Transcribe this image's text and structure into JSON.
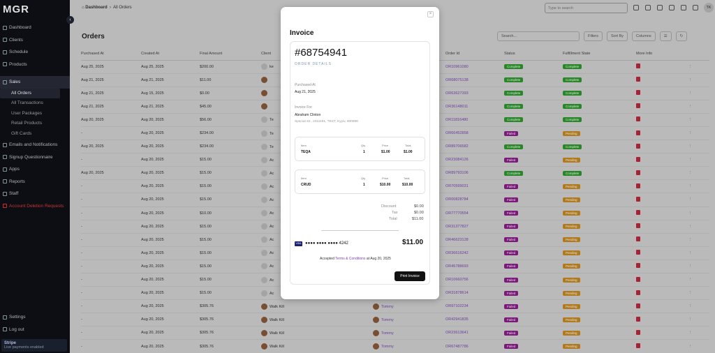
{
  "app": {
    "logo": "MGR"
  },
  "sidebar": {
    "items": [
      {
        "label": "Dashboard"
      },
      {
        "label": "Clients"
      },
      {
        "label": "Schedule"
      },
      {
        "label": "Products"
      },
      {
        "label": "Sales"
      }
    ],
    "sales_sub": [
      "All Orders",
      "All Transactions",
      "User Packages",
      "Retail Products",
      "Gift Cards"
    ],
    "items2": [
      {
        "label": "Emails and Notifications"
      },
      {
        "label": "Signup Questionnaire"
      },
      {
        "label": "Apps"
      },
      {
        "label": "Reports"
      },
      {
        "label": "Staff"
      },
      {
        "label": "Account Deletion Requests"
      }
    ],
    "settings": "Settings",
    "logout": "Log out",
    "stripe_title": "Stripe",
    "stripe_sub": "Live payments enabled"
  },
  "header": {
    "crumb_home": "Dashboard",
    "crumb_current": "All Orders",
    "search_placeholder": "Type to search",
    "avatar_initials": "TK"
  },
  "orders": {
    "title": "Orders",
    "search_placeholder": "Search...",
    "filters": "Filters",
    "sort": "Sort By",
    "columns": "Columns",
    "headers": [
      "Purchased At",
      "Created At",
      "Final Amount",
      "Client",
      "",
      "Order Id",
      "Status",
      "Fulfillment State",
      "More Info"
    ],
    "rows": [
      [
        "Aug 25, 2025",
        "Aug 25, 2025",
        "$200.00",
        "ke",
        "",
        "OR10961080",
        "Complete",
        "Complete"
      ],
      [
        "Aug 21, 2025",
        "Aug 21, 2025",
        "$11.00",
        "",
        "",
        "OR68075138",
        "Complete",
        "Complete"
      ],
      [
        "Aug 21, 2025",
        "Aug 15, 2025",
        "$0.00",
        "",
        "",
        "OR63627393",
        "Complete",
        "Complete"
      ],
      [
        "Aug 21, 2025",
        "Aug 21, 2025",
        "$45.00",
        "",
        "",
        "OR36148011",
        "Complete",
        "Complete"
      ],
      [
        "Aug 20, 2025",
        "Aug 20, 2025",
        "$56.00",
        "Te",
        "",
        "OR11816480",
        "Complete",
        "Complete"
      ],
      [
        "-",
        "Aug 20, 2025",
        "$234.00",
        "Te",
        "",
        "OR66452858",
        "Failed",
        "Pending"
      ],
      [
        "Aug 20, 2025",
        "Aug 20, 2025",
        "$234.00",
        "Te",
        "",
        "OR89706582",
        "Complete",
        "Complete"
      ],
      [
        "-",
        "Aug 20, 2025",
        "$15.00",
        "Ac",
        "",
        "OR23084126",
        "Failed",
        "Pending"
      ],
      [
        "Aug 20, 2025",
        "Aug 20, 2025",
        "$15.00",
        "Ac",
        "",
        "OR89793106",
        "Complete",
        "Complete"
      ],
      [
        "-",
        "Aug 20, 2025",
        "$15.00",
        "Ac",
        "",
        "OR70599031",
        "Failed",
        "Pending"
      ],
      [
        "-",
        "Aug 20, 2025",
        "$15.00",
        "Ac",
        "",
        "OR00828784",
        "Failed",
        "Pending"
      ],
      [
        "-",
        "Aug 20, 2025",
        "$10.00",
        "Ac",
        "",
        "OR77770554",
        "Failed",
        "Pending"
      ],
      [
        "-",
        "Aug 20, 2025",
        "$15.00",
        "Ac",
        "",
        "OR31377827",
        "Failed",
        "Pending"
      ],
      [
        "-",
        "Aug 20, 2025",
        "$15.00",
        "Ac",
        "",
        "OR46623128",
        "Failed",
        "Pending"
      ],
      [
        "-",
        "Aug 20, 2025",
        "$15.00",
        "Ac",
        "",
        "OR36616242",
        "Failed",
        "Pending"
      ],
      [
        "-",
        "Aug 20, 2025",
        "$15.00",
        "Ac",
        "",
        "OR45788693",
        "Failed",
        "Pending"
      ],
      [
        "-",
        "Aug 20, 2025",
        "$15.00",
        "Ac",
        "",
        "OR10660756",
        "Failed",
        "Pending"
      ],
      [
        "-",
        "Aug 20, 2025",
        "$15.00",
        "Ac",
        "",
        "OR31878614",
        "Failed",
        "Pending"
      ],
      [
        "-",
        "Aug 20, 2025",
        "$305.76",
        "Walk Kill",
        "Tommy",
        "OR97102234",
        "Failed",
        "Pending"
      ],
      [
        "-",
        "Aug 20, 2025",
        "$305.76",
        "Walk Kill",
        "Tommy",
        "OR42941835",
        "Failed",
        "Pending"
      ],
      [
        "-",
        "Aug 20, 2025",
        "$305.76",
        "Walk Kill",
        "Tommy",
        "OR23613641",
        "Failed",
        "Pending"
      ],
      [
        "-",
        "Aug 20, 2025",
        "$305.76",
        "Walk Kill",
        "Tommy",
        "OR67487786",
        "Failed",
        "Pending"
      ]
    ]
  },
  "invoice": {
    "title": "Invoice",
    "close": "×",
    "number": "#68754941",
    "order_details": "ORDER DETAILS",
    "purchased_at_label": "Purchased At",
    "purchased_at": "Aug 21, 2025",
    "invoice_for_label": "Invoice For",
    "client_name": "Abraham Clinton",
    "client_address": "Special str., 2311191, TEST, Kyyiv, 900898",
    "item_header": "Item",
    "qty_header": "Qty",
    "price_header": "Price",
    "total_header": "Total",
    "items": [
      {
        "name": "TEQA",
        "qty": "1",
        "price": "$1.00",
        "total": "$1.00"
      },
      {
        "name": "CRUD",
        "qty": "1",
        "price": "$10.00",
        "total": "$10.00"
      }
    ],
    "discount_label": "Discount",
    "discount": "$0.00",
    "tax_label": "Tax",
    "tax": "$0.00",
    "total_label": "Total",
    "total": "$11.00",
    "card_brand": "VISA",
    "card_masked": "●●●● ●●●● ●●●● 4242",
    "grand_total": "$11.00",
    "terms_prefix": "Accepted",
    "terms_link": "Terms & Conditions",
    "terms_suffix": "at Aug 20, 2025",
    "print": "Print Invoice"
  }
}
